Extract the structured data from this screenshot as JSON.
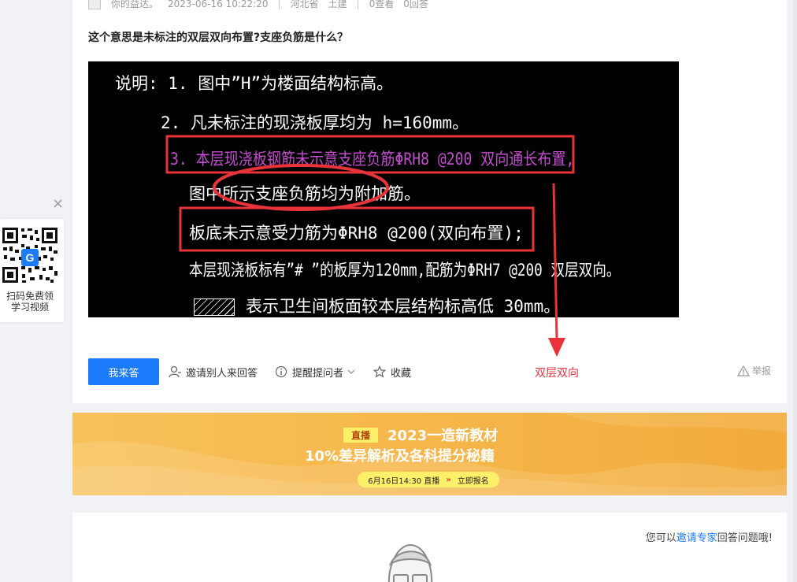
{
  "question": {
    "meta": {
      "user": "你的益达。",
      "datetime": "2023-06-16 10:22:20",
      "location": "河北省",
      "category": "土建",
      "views": "0查看",
      "answers": "0回答"
    },
    "title": "这个意思是未标注的双层双向布置?支座负筋是什么？",
    "image_lines": [
      "说明: 1. 图中”H”为楼面结构标高。",
      "2. 凡未标注的现浇板厚均为 h=160mm。",
      "3. 本层现浇板钢筋未示意支座负筋ΦRH8 @200 双向通长布置,",
      "图中所示支座负筋均为附加筋。",
      "板底未示意受力筋为ΦRH8 @200(双向布置);",
      "本层现浇板标有”# ”的板厚为120mm,配筋为ΦRH7 @200 双层双向。",
      "表示卫生间板面较本层结构标高低 30mm。"
    ],
    "annotation": "双层双向",
    "actions": {
      "answer": "我来答",
      "invite": "邀请别人来回答",
      "remind": "提醒提问者",
      "favorite": "收藏",
      "report": "举报"
    }
  },
  "banner": {
    "tag": "直播",
    "title1": "2023一造新教材",
    "title2": "10%差异解析及各科提分秘籍",
    "time": "6月16日14:30 直播",
    "chevron": "»",
    "signup": "立即报名"
  },
  "invite_text": {
    "prefix": "您可以",
    "link": "邀请专家",
    "suffix": "回答问题哦!"
  },
  "qr_widget": {
    "close": "×",
    "line1": "扫码免费领",
    "line2": "学习视频"
  },
  "colors": {
    "primary": "#1b7bfa",
    "annotation_red": "#e8333a",
    "banner_orange": "#f5b447",
    "cad_magenta": "#c44dcf"
  }
}
